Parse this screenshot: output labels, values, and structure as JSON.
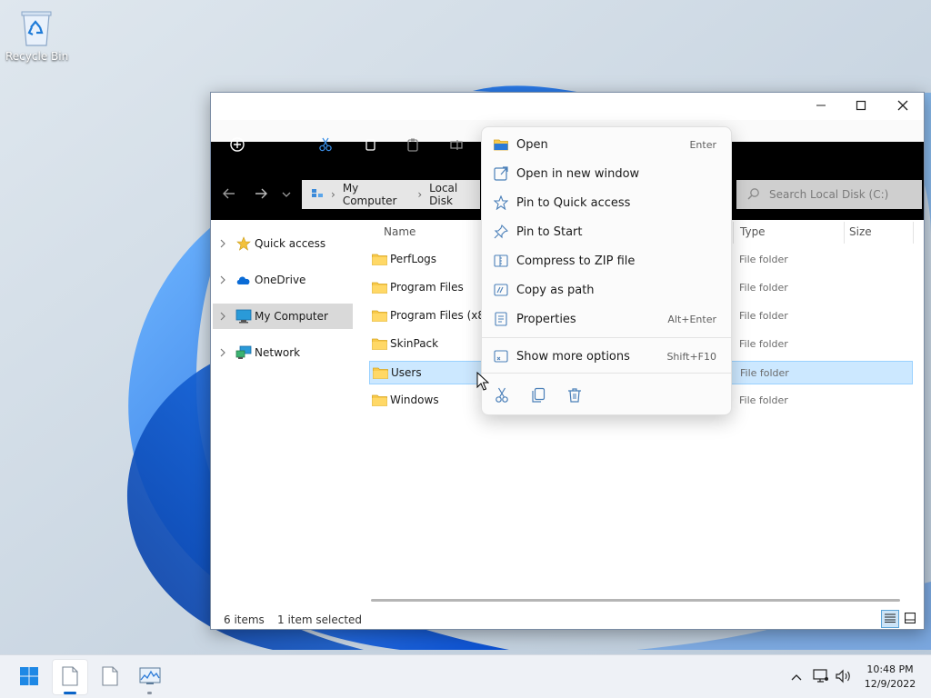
{
  "desktop": {
    "recycle_bin_label": "Recycle Bin"
  },
  "window": {
    "title_buttons": {
      "minimize": "minimize-icon",
      "maximize": "maximize-icon",
      "close": "close-icon"
    },
    "toolbar_icons": [
      "new-icon",
      "cut-icon",
      "copy-icon",
      "paste-icon",
      "rename-icon"
    ],
    "address": {
      "segments": [
        "My Computer",
        "Local Disk"
      ],
      "separator": "›"
    },
    "search": {
      "placeholder": "Search Local Disk (C:)"
    },
    "nav": [
      {
        "label": "Quick access",
        "icon": "star-icon"
      },
      {
        "label": "OneDrive",
        "icon": "cloud-icon"
      },
      {
        "label": "My Computer",
        "icon": "monitor-icon",
        "selected": true
      },
      {
        "label": "Network",
        "icon": "network-icon"
      }
    ],
    "columns": {
      "name": "Name",
      "type": "Type",
      "size": "Size"
    },
    "files": [
      {
        "name": "PerfLogs",
        "type": "File folder"
      },
      {
        "name": "Program Files",
        "type": "File folder"
      },
      {
        "name": "Program Files (x86)",
        "type": "File folder"
      },
      {
        "name": "SkinPack",
        "type": "File folder"
      },
      {
        "name": "Users",
        "type": "File folder",
        "selected": true
      },
      {
        "name": "Windows",
        "type": "File folder"
      }
    ],
    "status": {
      "count": "6 items",
      "selection": "1 item selected"
    }
  },
  "context_menu": {
    "items": [
      {
        "label": "Open",
        "shortcut": "Enter",
        "icon": "folder-open-icon"
      },
      {
        "label": "Open in new window",
        "shortcut": "",
        "icon": "open-new-window-icon"
      },
      {
        "label": "Pin to Quick access",
        "shortcut": "",
        "icon": "star-outline-icon"
      },
      {
        "label": "Pin to Start",
        "shortcut": "",
        "icon": "pin-icon"
      },
      {
        "label": "Compress to ZIP file",
        "shortcut": "",
        "icon": "zip-icon"
      },
      {
        "label": "Copy as path",
        "shortcut": "",
        "icon": "path-icon"
      },
      {
        "label": "Properties",
        "shortcut": "Alt+Enter",
        "icon": "properties-icon"
      }
    ],
    "more": {
      "label": "Show more options",
      "shortcut": "Shift+F10",
      "icon": "more-options-icon"
    },
    "bottom_actions": [
      "cut-icon",
      "copy-icon",
      "delete-icon"
    ]
  },
  "taskbar": {
    "clock": {
      "time": "10:48 PM",
      "date": "12/9/2022"
    },
    "accent": "#0a64c8"
  }
}
